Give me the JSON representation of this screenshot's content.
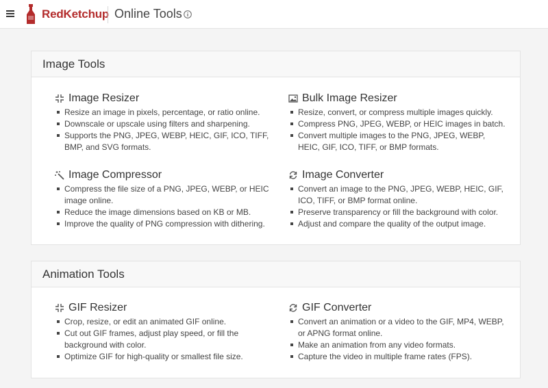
{
  "header": {
    "brand": "RedKetchup",
    "title": "Online Tools"
  },
  "sections": [
    {
      "title": "Image Tools",
      "tools": [
        {
          "name": "Image Resizer",
          "icon": "compress-arrows-icon",
          "bullets": [
            "Resize an image in pixels, percentage, or ratio online.",
            "Downscale or upscale using filters and sharpening.",
            "Supports the PNG, JPEG, WEBP, HEIC, GIF, ICO, TIFF, BMP, and SVG formats."
          ]
        },
        {
          "name": "Bulk Image Resizer",
          "icon": "image-icon",
          "bullets": [
            "Resize, convert, or compress multiple images quickly.",
            "Compress PNG, JPEG, WEBP, or HEIC images in batch.",
            "Convert multiple images to the PNG, JPEG, WEBP, HEIC, GIF, ICO, TIFF, or BMP formats."
          ]
        },
        {
          "name": "Image Compressor",
          "icon": "magic-wand-icon",
          "bullets": [
            "Compress the file size of a PNG, JPEG, WEBP, or HEIC image online.",
            "Reduce the image dimensions based on KB or MB.",
            "Improve the quality of PNG compression with dithering."
          ]
        },
        {
          "name": "Image Converter",
          "icon": "convert-arrows-icon",
          "bullets": [
            "Convert an image to the PNG, JPEG, WEBP, HEIC, GIF, ICO, TIFF, or BMP format online.",
            "Preserve transparency or fill the background with color.",
            "Adjust and compare the quality of the output image."
          ]
        }
      ]
    },
    {
      "title": "Animation Tools",
      "tools": [
        {
          "name": "GIF Resizer",
          "icon": "compress-arrows-icon",
          "bullets": [
            "Crop, resize, or edit an animated GIF online.",
            "Cut out GIF frames, adjust play speed, or fill the background with color.",
            "Optimize GIF for high-quality or smallest file size."
          ]
        },
        {
          "name": "GIF Converter",
          "icon": "convert-arrows-icon",
          "bullets": [
            "Convert an animation or a video to the GIF, MP4, WEBP, or APNG format online.",
            "Make an animation from any video formats.",
            "Capture the video in multiple frame rates (FPS)."
          ]
        }
      ]
    }
  ]
}
